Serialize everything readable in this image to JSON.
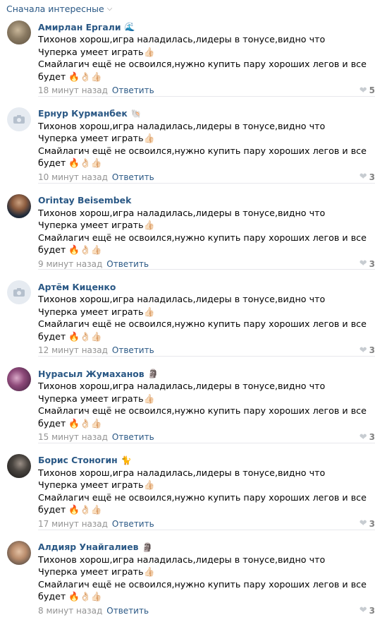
{
  "sort": {
    "label": "Сначала интересные"
  },
  "reply_label": "Ответить",
  "comments": [
    {
      "author": "Амирлан Ергали",
      "badge": "🌊",
      "line1": "Тихонов хорош,игра наладилась,лидеры в тонусе,видно что Чуперка умеет играть👍🏻",
      "line2": "Смайлагич ещё не освоился,нужно купить пару хороших легов и все будет 🔥👌🏻👍🏻",
      "time": "18 минут назад",
      "likes": "5",
      "avatar": "photo-dog"
    },
    {
      "author": "Ернур Курманбек",
      "badge": "🐚",
      "line1": "Тихонов хорош,игра наладилась,лидеры в тонусе,видно что Чуперка умеет играть👍🏻",
      "line2": "Смайлагич ещё не освоился,нужно купить пару хороших легов и все будет 🔥👌🏻👍🏻",
      "time": "10 минут назад",
      "likes": "3",
      "avatar": "camera-placeholder"
    },
    {
      "author": "Orintay Beisembek",
      "badge": "",
      "line1": "Тихонов хорош,игра наладилась,лидеры в тонусе,видно что Чуперка умеет играть👍🏻",
      "line2": "Смайлагич ещё не освоился,нужно купить пару хороших легов и все будет 🔥👌🏻👍🏻",
      "time": "9 минут назад",
      "likes": "3",
      "avatar": "photo-person"
    },
    {
      "author": "Артём Киценко",
      "badge": "",
      "line1": "Тихонов хорош,игра наладилась,лидеры в тонусе,видно что Чуперка умеет играть👍🏻",
      "line2": "Смайлагич ещё не освоился,нужно купить пару хороших легов и все будет 🔥👌🏻👍🏻",
      "time": "12 минут назад",
      "likes": "3",
      "avatar": "camera-placeholder"
    },
    {
      "author": "Нурасыл Жумаханов",
      "badge": "🗿",
      "line1": "Тихонов хорош,игра наладилась,лидеры в тонусе,видно что Чуперка умеет играть👍🏻",
      "line2": "Смайлагич ещё не освоился,нужно купить пару хороших легов и все будет 🔥👌🏻👍🏻",
      "time": "15 минут назад",
      "likes": "3",
      "avatar": "photo-purple"
    },
    {
      "author": "Борис Стоногин",
      "badge": "🐈",
      "line1": "Тихонов хорош,игра наладилась,лидеры в тонусе,видно что Чуперка умеет играть👍🏻",
      "line2": "Смайлагич ещё не освоился,нужно купить пару хороших легов и все будет 🔥👌🏻👍🏻",
      "time": "17 минут назад",
      "likes": "3",
      "avatar": "photo-dark"
    },
    {
      "author": "Алдияр Унайгалиев",
      "badge": "🗿",
      "line1": "Тихонов хорош,игра наладилась,лидеры в тонусе,видно что Чуперка умеет играть👍🏻",
      "line2": "Смайлагич ещё не освоился,нужно купить пару хороших легов и все будет 🔥👌🏻👍🏻",
      "time": "8 минут назад",
      "likes": "3",
      "avatar": "photo-face"
    }
  ]
}
